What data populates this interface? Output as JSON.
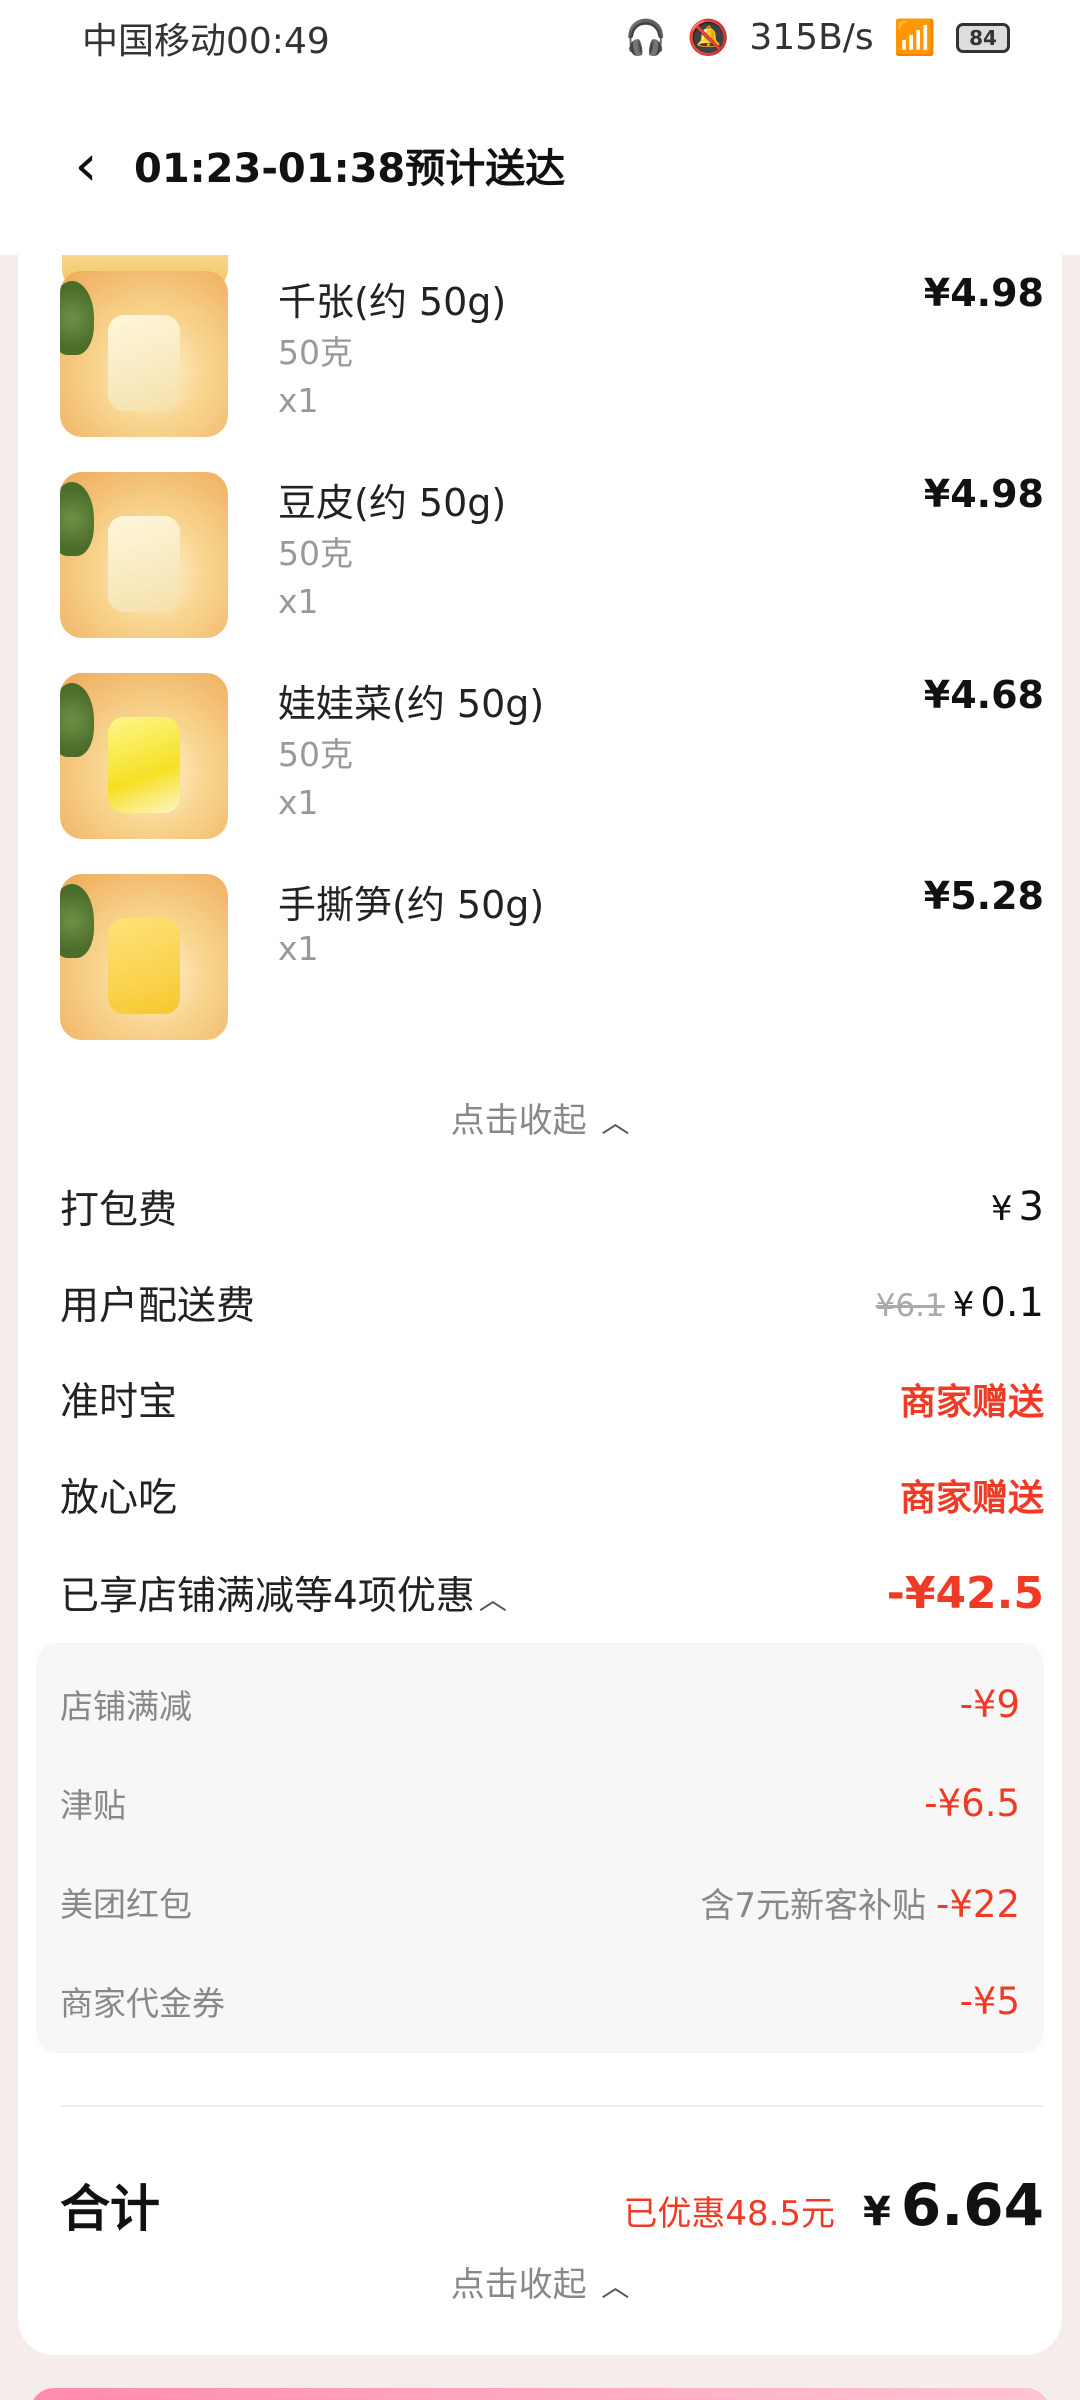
{
  "status_bar": {
    "carrier_time": "中国移动00:49",
    "net_speed": "315B/s",
    "battery": "84",
    "icons": [
      "headphones-icon",
      "bell-muted-icon",
      "wifi-icon",
      "signal-icon",
      "battery-icon"
    ]
  },
  "nav": {
    "title": "01:23-01:38预计送达",
    "back_icon": "chevron-left-icon"
  },
  "products": [
    {
      "name": "千张(约 50g)",
      "spec": "50克",
      "qty": "x1",
      "price": "¥4.98"
    },
    {
      "name": "豆皮(约 50g)",
      "spec": "50克",
      "qty": "x1",
      "price": "¥4.98"
    },
    {
      "name": "娃娃菜(约 50g)",
      "spec": "50克",
      "qty": "x1",
      "price": "¥4.68"
    },
    {
      "name": "手撕笋(约 50g)",
      "qty": "x1",
      "price": "¥5.28"
    }
  ],
  "collapse_label": "点击收起",
  "fees": {
    "packing": {
      "label": "打包费",
      "yen": "¥",
      "value": "3"
    },
    "delivery": {
      "label": "用户配送费",
      "original": "¥6.1",
      "yen": "¥",
      "value": "0.1"
    },
    "on_time": {
      "label": "准时宝",
      "value": "商家赠送"
    },
    "safe_eat": {
      "label": "放心吃",
      "value": "商家赠送"
    },
    "discounts": {
      "label": "已享店铺满减等4项优惠",
      "value": "-¥42.5"
    }
  },
  "discount_details": [
    {
      "label": "店铺满减",
      "note": "",
      "value": "-¥9"
    },
    {
      "label": "津贴",
      "note": "",
      "value": "-¥6.5"
    },
    {
      "label": "美团红包",
      "note": "含7元新客补贴",
      "value": "-¥22"
    },
    {
      "label": "商家代金券",
      "note": "",
      "value": "-¥5"
    }
  ],
  "total": {
    "label": "合计",
    "saved": "已优惠48.5元",
    "yen": "¥",
    "amount": "6.64"
  },
  "colors": {
    "accent_red": "#ef3b25",
    "page_background": "#f6eceb"
  }
}
